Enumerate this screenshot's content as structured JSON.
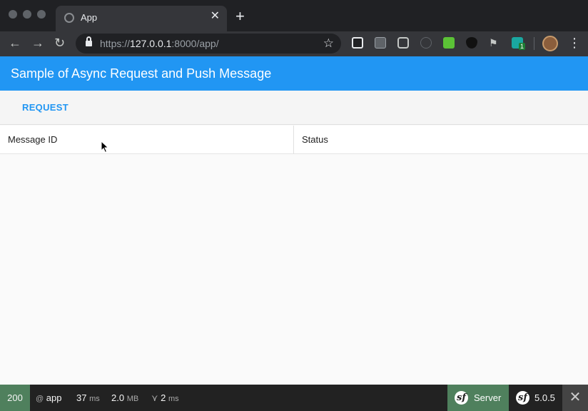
{
  "browser": {
    "tab_title": "App",
    "url_scheme": "https://",
    "url_host": "127.0.0.1",
    "url_rest": ":8000/app/",
    "extension_badge": "1"
  },
  "app": {
    "title": "Sample of Async Request and Push Message",
    "request_button": "REQUEST",
    "table": {
      "columns": [
        "Message ID",
        "Status"
      ],
      "rows": []
    },
    "accent_color": "#2196f3"
  },
  "symfony_toolbar": {
    "status_code": "200",
    "route_prefix": "@",
    "route": "app",
    "time_value": "37",
    "time_unit": "ms",
    "memory_value": "2.0",
    "memory_unit": "MB",
    "queries_value": "2",
    "queries_unit": "ms",
    "server_label": "Server",
    "version": "5.0.5"
  }
}
